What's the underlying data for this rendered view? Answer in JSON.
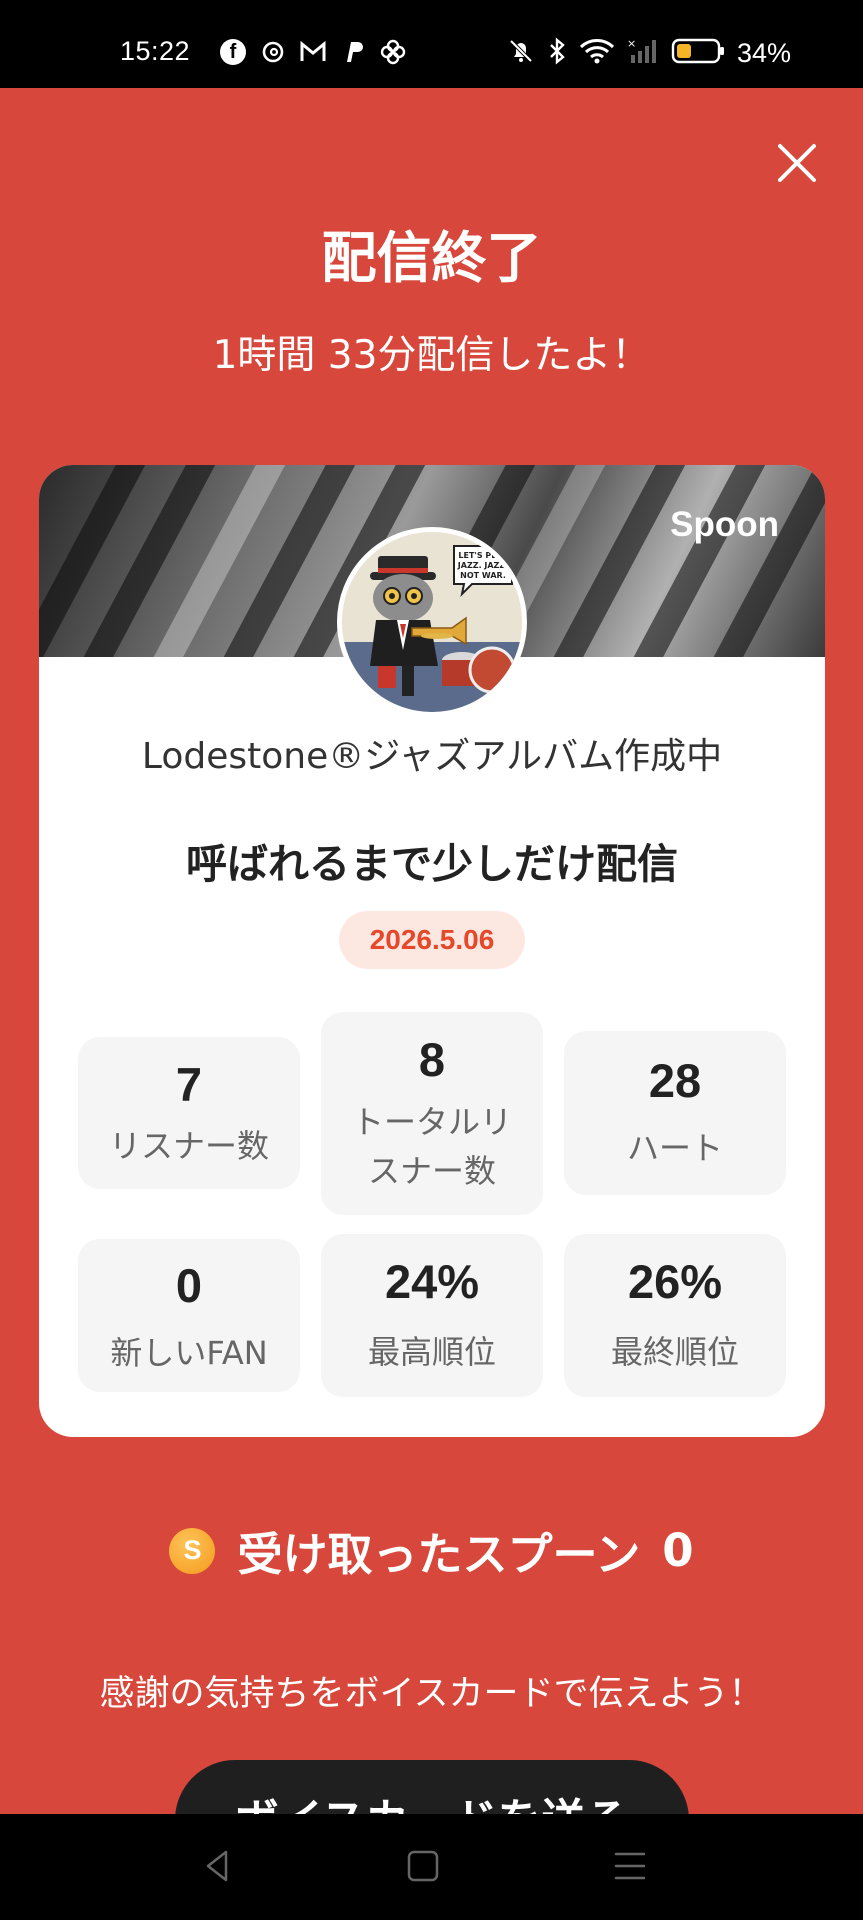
{
  "status_bar": {
    "time": "15:22",
    "apps": [
      "facebook-icon",
      "threads-icon",
      "gmail-icon",
      "paypal-icon",
      "pinwheel-icon"
    ],
    "battery_percent": "34%",
    "battery_color": "#f5b526"
  },
  "screen": {
    "background_color": "#d8473b",
    "title": "配信終了",
    "duration_text": "1時間 33分配信したよ！"
  },
  "card": {
    "brand": "Spoon",
    "avatar_speech_text": "LET'S PLAY JAZZ. JAZZ, NOT WAR.",
    "user_name": "Lodestone®ジャズアルバム作成中",
    "broadcast_title": "呼ばれるまで少しだけ配信",
    "date": "2026.5.06",
    "accent_color": "#e5482a",
    "stats": [
      {
        "value": "7",
        "label": "リスナー数"
      },
      {
        "value": "8",
        "label": "トータルリスナー数",
        "label_line1": "トータルリ",
        "label_line2": "スナー数"
      },
      {
        "value": "28",
        "label": "ハート"
      },
      {
        "value": "0",
        "label": "新しいFAN"
      },
      {
        "value": "24%",
        "label": "最高順位"
      },
      {
        "value": "26%",
        "label": "最終順位"
      }
    ]
  },
  "spoons": {
    "icon": "spoon-coin-icon",
    "coin_letter": "S",
    "label": "受け取ったスプーン",
    "count": "0"
  },
  "thanks_text": "感謝の気持ちをボイスカードで伝えよう！",
  "voice_card_button": "ボイスカードを送る",
  "nav_bar": {
    "buttons": [
      "back-icon",
      "home-icon",
      "menu-icon"
    ]
  }
}
